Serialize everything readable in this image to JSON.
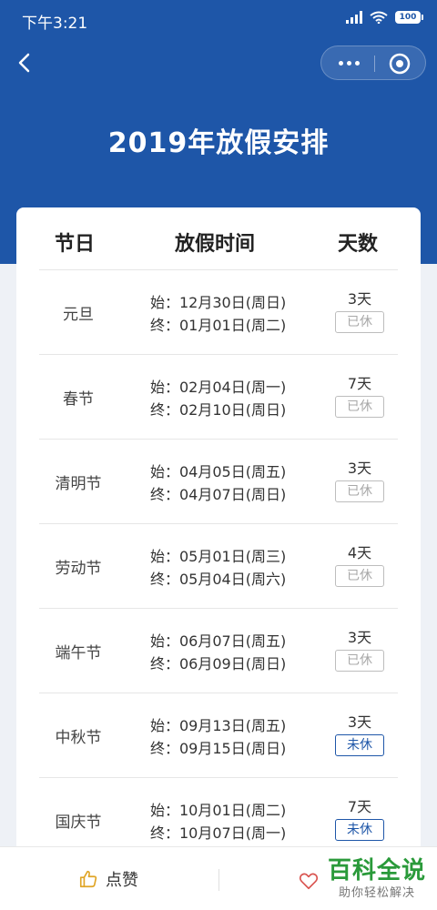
{
  "status_bar": {
    "time": "下午3:21",
    "battery": "100"
  },
  "header": {
    "title": "2019年放假安排"
  },
  "table": {
    "columns": [
      "节日",
      "放假时间",
      "天数"
    ],
    "rows": [
      {
        "name": "元旦",
        "start": "始：12月30日(周日)",
        "end": "终：01月01日(周二)",
        "days": "3天",
        "status": "已休",
        "rested": true
      },
      {
        "name": "春节",
        "start": "始：02月04日(周一)",
        "end": "终：02月10日(周日)",
        "days": "7天",
        "status": "已休",
        "rested": true
      },
      {
        "name": "清明节",
        "start": "始：04月05日(周五)",
        "end": "终：04月07日(周日)",
        "days": "3天",
        "status": "已休",
        "rested": true
      },
      {
        "name": "劳动节",
        "start": "始：05月01日(周三)",
        "end": "终：05月04日(周六)",
        "days": "4天",
        "status": "已休",
        "rested": true
      },
      {
        "name": "端午节",
        "start": "始：06月07日(周五)",
        "end": "终：06月09日(周日)",
        "days": "3天",
        "status": "已休",
        "rested": true
      },
      {
        "name": "中秋节",
        "start": "始：09月13日(周五)",
        "end": "终：09月15日(周日)",
        "days": "3天",
        "status": "未休",
        "rested": false
      },
      {
        "name": "国庆节",
        "start": "始：10月01日(周二)",
        "end": "终：10月07日(周一)",
        "days": "7天",
        "status": "未休",
        "rested": false
      }
    ]
  },
  "bottom_bar": {
    "like_label": "点赞"
  },
  "watermark": {
    "main": "百科全说",
    "sub": "助你轻松解决"
  },
  "colors": {
    "brand_blue": "#1e56a8",
    "rested_badge": "#a8a8a8",
    "watermark_green": "#2a9a3a"
  },
  "icons": {
    "back": "chevron-left-icon",
    "more": "more-dots-icon",
    "close": "target-icon",
    "like": "thumbs-up-icon",
    "favorite": "heart-icon"
  }
}
